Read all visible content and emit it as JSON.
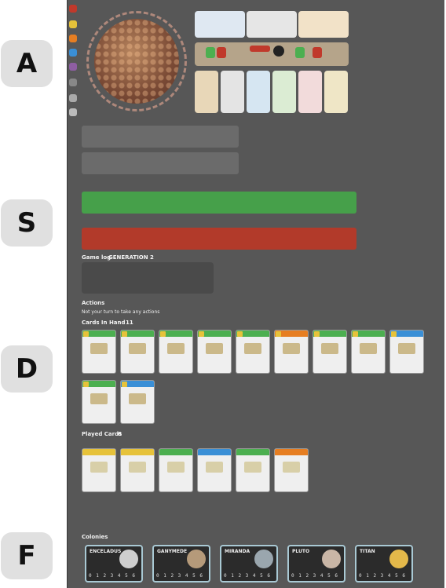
{
  "shortcut_keys": [
    "A",
    "S",
    "D",
    "F"
  ],
  "players": [
    {
      "color": "green",
      "hex": "#4caf50"
    },
    {
      "color": "red",
      "hex": "#c0392b"
    }
  ],
  "sections": {
    "game_log_title": "Game log",
    "generation_label": "GENERATION 2",
    "actions_title": "Actions",
    "actions_text": "Not your turn to take any actions",
    "cards_in_hand_title": "Cards In Hand",
    "cards_in_hand_count": "11",
    "played_cards_title": "Played Cards",
    "played_cards_count": "6",
    "colonies_title": "Colonies"
  },
  "hand_cards": [
    {
      "band": "#4caf50"
    },
    {
      "band": "#4caf50"
    },
    {
      "band": "#4caf50"
    },
    {
      "band": "#4caf50"
    },
    {
      "band": "#4caf50"
    },
    {
      "band": "#e67e22"
    },
    {
      "band": "#4caf50"
    },
    {
      "band": "#4caf50"
    },
    {
      "band": "#3a8fd6"
    },
    {
      "band": "#4caf50"
    },
    {
      "band": "#3a8fd6"
    }
  ],
  "played_cards": [
    {
      "band": "#e6c23a"
    },
    {
      "band": "#e6c23a"
    },
    {
      "band": "#4caf50"
    },
    {
      "band": "#3a8fd6"
    },
    {
      "band": "#4caf50"
    },
    {
      "band": "#e67e22"
    }
  ],
  "colonies": [
    {
      "name": "ENCELADUS",
      "orb": "#cfcfcf",
      "track": "0 1 2 3 4 5 6"
    },
    {
      "name": "GANYMEDE",
      "orb": "#b59a7a",
      "track": "0 1 2 3 4 5 6"
    },
    {
      "name": "MIRANDA",
      "orb": "#9aa6ae",
      "track": "0 1 2 3 4 5 6"
    },
    {
      "name": "PLUTO",
      "orb": "#c9b6a6",
      "track": "0 1 2 3 4 5 6"
    },
    {
      "name": "TITAN",
      "orb": "#e3b84a",
      "track": "0 1 2 3 4 5 6"
    }
  ],
  "colors": {
    "board_bg": "#575757",
    "green_player": "#46a04a",
    "red_player": "#b23a2a",
    "panel": "#e8e4dc"
  }
}
